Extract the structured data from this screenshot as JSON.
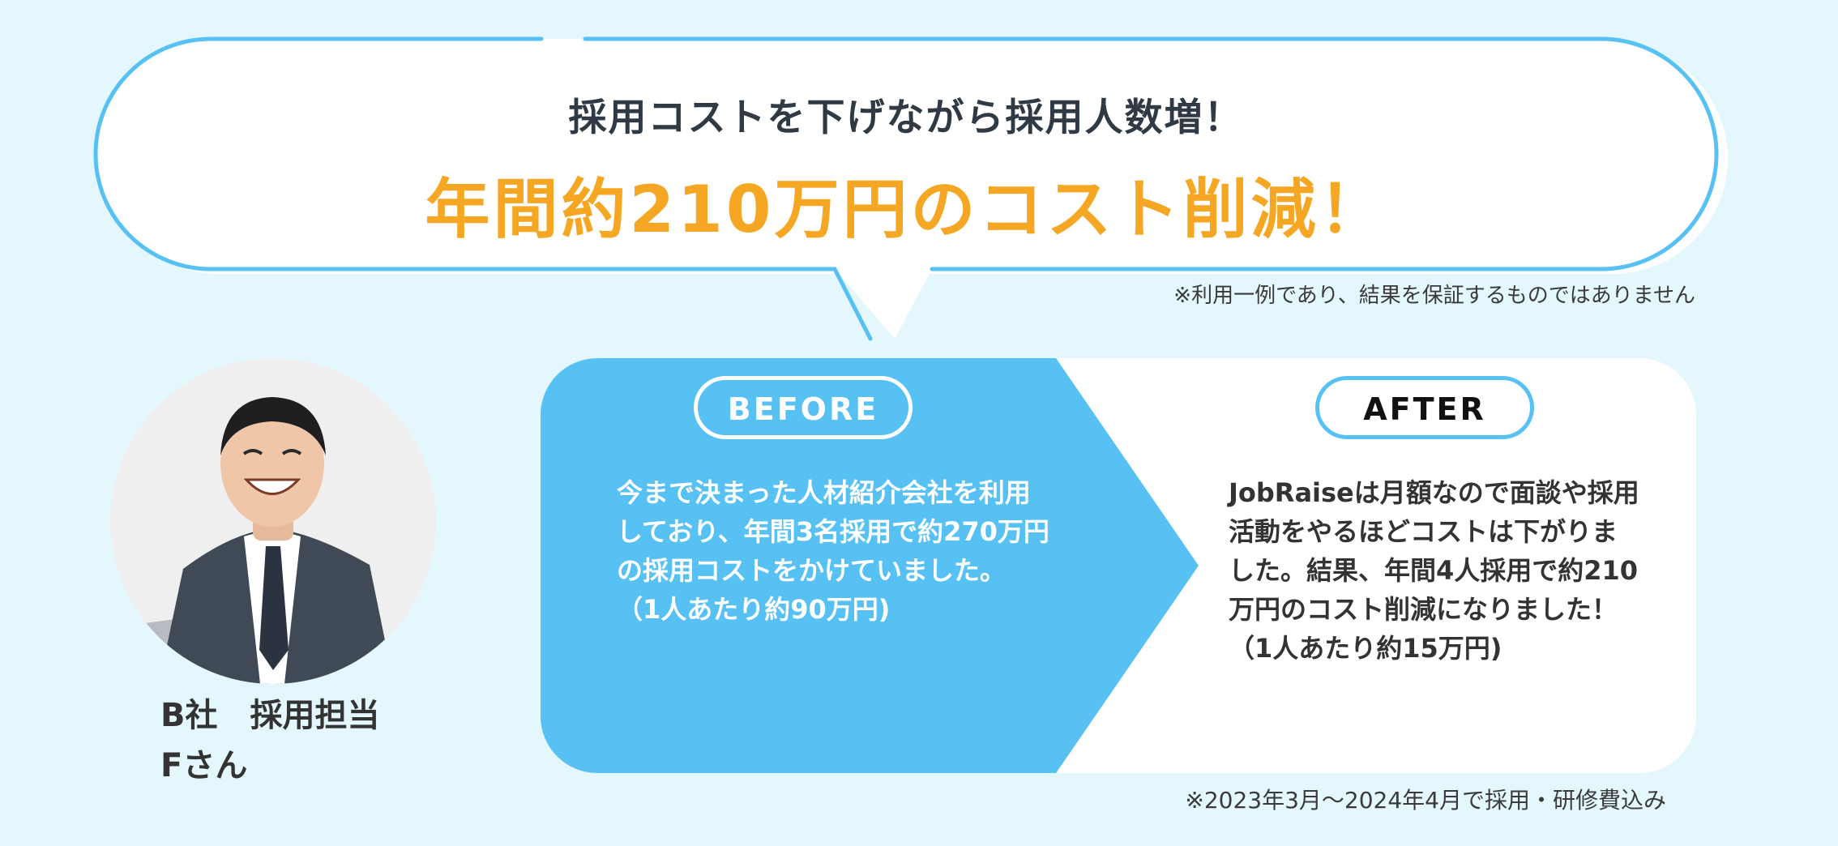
{
  "bubble": {
    "subheadline": "採用コストを下げながら採用人数増！",
    "headline": "年間約210万円のコスト削減！",
    "disclaimer": "※利用一例であり、結果を保証するものではありません"
  },
  "person": {
    "label_line1": "B社　採用担当",
    "label_line2": "Fさん",
    "photo_icon": "person-photo-icon"
  },
  "comparison": {
    "before": {
      "label": "BEFORE",
      "text": "今まで決まった人材紹介会社を利用\nしており、年間3名採用で約270万円\nの採用コストをかけていました。\n（1人あたり約90万円)"
    },
    "after": {
      "label": "AFTER",
      "text": "JobRaiseは月額なので面談や採用\n活動をやるほどコストは下がりま\nした。結果、年間4人採用で約210\n万円のコスト削減になりました！\n（1人あたり約15万円)"
    },
    "disclaimer": "※2023年3月〜2024年4月で採用・研修費込み"
  },
  "colors": {
    "background": "#e4f7fd",
    "accent_blue": "#56c1f2",
    "accent_orange": "#f5a623",
    "text_dark": "#2f3a45"
  }
}
